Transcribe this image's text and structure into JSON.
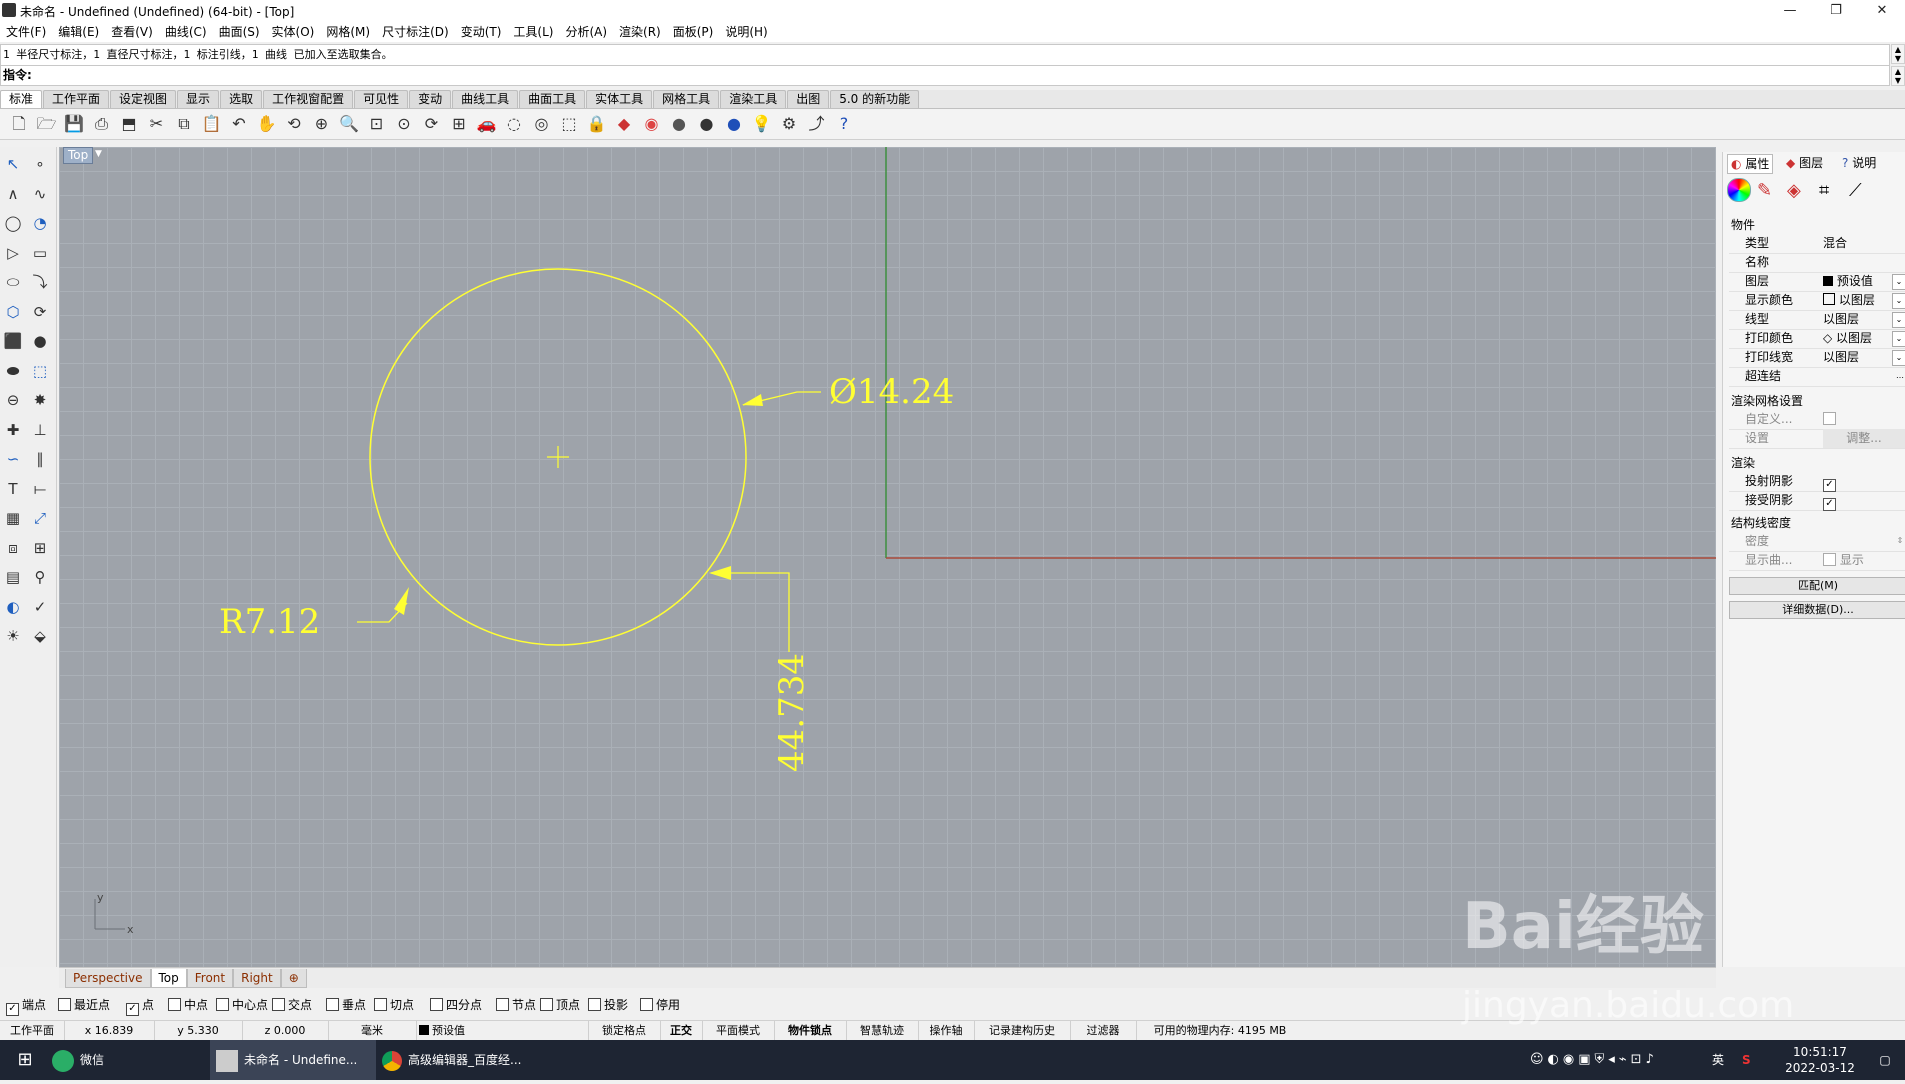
{
  "window": {
    "title": "未命名 - Undefined (Undefined) (64-bit) - [Top]",
    "minimize": "—",
    "restore": "❐",
    "close": "✕"
  },
  "menu": [
    "文件(F)",
    "编辑(E)",
    "查看(V)",
    "曲线(C)",
    "曲面(S)",
    "实体(O)",
    "网格(M)",
    "尺寸标注(D)",
    "变动(T)",
    "工具(L)",
    "分析(A)",
    "渲染(R)",
    "面板(P)",
    "说明(H)"
  ],
  "command": {
    "history": "1 半径尺寸标注，1 直径尺寸标注，1 标注引线，1 曲线 已加入至选取集合。",
    "prompt": "指令:",
    "value": ""
  },
  "toolbar_tabs": [
    "标准",
    "工作平面",
    "设定视图",
    "显示",
    "选取",
    "工作视窗配置",
    "可见性",
    "变动",
    "曲线工具",
    "曲面工具",
    "实体工具",
    "网格工具",
    "渲染工具",
    "出图",
    "5.0 的新功能"
  ],
  "toolbar_icons": [
    "new-file-icon",
    "open-file-icon",
    "save-icon",
    "print-icon",
    "import-icon",
    "cut-icon",
    "copy-icon",
    "paste-icon",
    "undo-icon",
    "pan-icon",
    "rotate-view-icon",
    "zoom-dynamic-icon",
    "zoom-window-icon",
    "zoom-extents-icon",
    "zoom-selected-icon",
    "rotate-camera-icon",
    "four-viewports-icon",
    "car-icon",
    "hide-object-icon",
    "show-object-icon",
    "select-filter-icon",
    "lock-icon",
    "layer-icon",
    "render-color-icon",
    "shaded-sphere-icon",
    "rendered-sphere-icon",
    "blue-sphere-icon",
    "light-icon",
    "settings-gear-icon",
    "history-icon",
    "help-icon"
  ],
  "viewport": {
    "name": "Top",
    "dim_diameter": "Ø14.24",
    "dim_radius": "R7.12",
    "dim_linear": "44.734",
    "axis_x": "x",
    "axis_y": "y"
  },
  "viewport_tabs": [
    "Perspective",
    "Top",
    "Front",
    "Right",
    "⊕"
  ],
  "panel": {
    "tabs": [
      "属性",
      "图层",
      "说明"
    ],
    "object_header": "物件",
    "rows": [
      {
        "k": "类型",
        "v": "混合"
      },
      {
        "k": "名称",
        "v": ""
      },
      {
        "k": "图层",
        "v": "预设值"
      },
      {
        "k": "显示颜色",
        "v": "以图层"
      },
      {
        "k": "线型",
        "v": "以图层"
      },
      {
        "k": "打印颜色",
        "v": "以图层"
      },
      {
        "k": "打印线宽",
        "v": "以图层"
      },
      {
        "k": "超连结",
        "v": ""
      }
    ],
    "mesh_header": "渲染网格设置",
    "mesh_custom": "自定义...",
    "mesh_settings": "设置",
    "mesh_adjust": "调整...",
    "render_header": "渲染",
    "cast_shadow": "投射阴影",
    "receive_shadow": "接受阴影",
    "isocurve_header": "结构线密度",
    "density": "密度",
    "show_curve": "显示曲...",
    "show_label": "显示",
    "match_btn": "匹配(M)",
    "details_btn": "详细数据(D)..."
  },
  "osnaps": [
    {
      "label": "端点",
      "checked": true
    },
    {
      "label": "最近点",
      "checked": false
    },
    {
      "label": "点",
      "checked": true
    },
    {
      "label": "中点",
      "checked": false
    },
    {
      "label": "中心点",
      "checked": false
    },
    {
      "label": "交点",
      "checked": false
    },
    {
      "label": "垂点",
      "checked": false
    },
    {
      "label": "切点",
      "checked": false
    },
    {
      "label": "四分点",
      "checked": false
    },
    {
      "label": "节点",
      "checked": false
    },
    {
      "label": "顶点",
      "checked": false
    },
    {
      "label": "投影",
      "checked": false
    },
    {
      "label": "停用",
      "checked": false
    }
  ],
  "status": {
    "cplane": "工作平面",
    "x": "x 16.839",
    "y": "y 5.330",
    "z": "z 0.000",
    "units": "毫米",
    "layer": "预设值",
    "grid_snap": "锁定格点",
    "ortho": "正交",
    "planar": "平面模式",
    "osnap": "物件锁点",
    "smarttrack": "智慧轨迹",
    "gumball": "操作轴",
    "history": "记录建构历史",
    "filter": "过滤器",
    "memory": "可用的物理内存: 4195 MB"
  },
  "taskbar": {
    "wechat": "微信",
    "rhino": "未命名 - Undefine...",
    "chrome": "高级编辑器_百度经...",
    "ime": "英",
    "time": "10:51:17",
    "date": "2022-03-12"
  },
  "watermark": {
    "brand": "Bai经验",
    "url": "jingyan.baidu.com"
  },
  "colors": {
    "dimension": "#ffff33",
    "x_axis": "#a94a3a",
    "y_axis": "#3f8f3f",
    "viewport_bg": "#9ea3aa"
  }
}
